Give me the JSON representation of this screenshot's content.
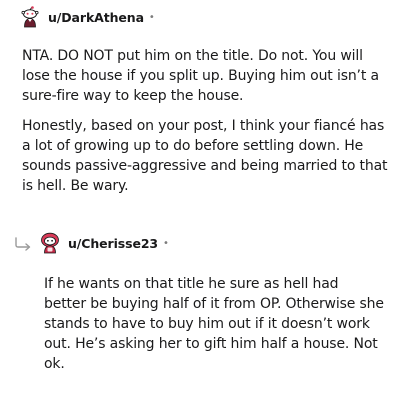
{
  "comments": [
    {
      "username": "u/DarkAthena",
      "separator": "•",
      "avatar_icon": "snoo-avatar-icon",
      "paragraphs": [
        "NTA. DO NOT put him on the title. Do not. You will lose the house if you split up. Buying him out isn’t a sure-fire way to keep the house.",
        "Honestly, based on your post, I think your fiancé has a lot of growing up to do before settling down. He sounds passive-aggressive and being married to that is hell. Be wary."
      ]
    },
    {
      "username": "u/Cherisse23",
      "separator": "•",
      "avatar_icon": "snoo-avatar-icon",
      "reply_icon": "reply-arrow-icon",
      "paragraphs": [
        "If he wants on that title he sure as hell had better be buying half of it from OP. Otherwise she stands to have to buy him out if it doesn’t work out. He’s asking her to gift him half a house. Not ok."
      ]
    }
  ],
  "colors": {
    "text": "#1a1a1b",
    "muted": "#7c7c7c",
    "avatar_accent": "#d93a58"
  }
}
